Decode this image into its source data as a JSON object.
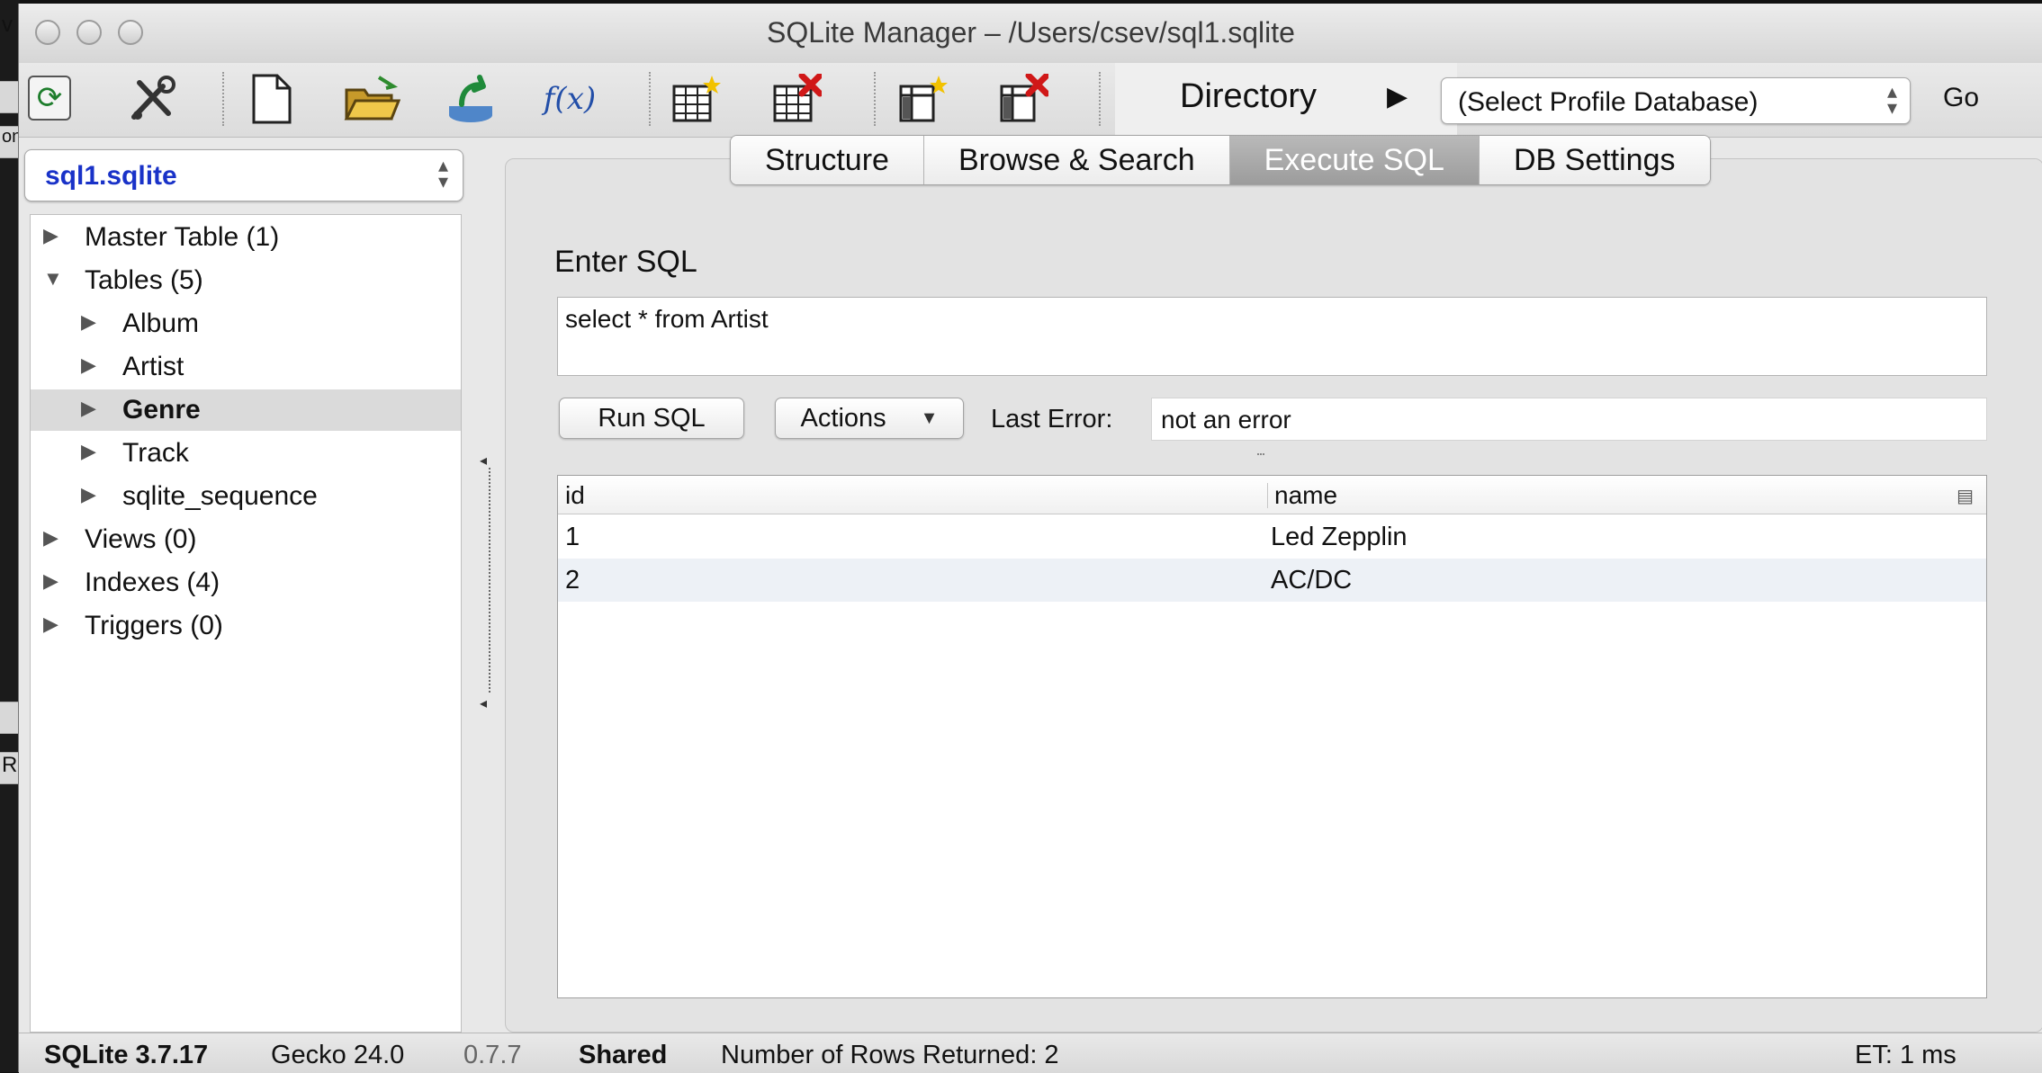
{
  "window": {
    "title": "SQLite Manager – /Users/csev/sql1.sqlite"
  },
  "background_left": {
    "letters": [
      "v",
      "on",
      "R"
    ]
  },
  "toolbar": {
    "fx_label": "f(x)",
    "directory_label": "Directory",
    "profile_select_value": "(Select Profile Database)",
    "go_label": "Go",
    "icons": [
      "reload-icon",
      "tools-icon",
      "new-db-icon",
      "open-db-icon",
      "export-icon",
      "function-icon",
      "create-table-icon",
      "drop-table-icon",
      "create-index-icon",
      "drop-index-icon"
    ]
  },
  "sidebar": {
    "db_select_value": "sql1.sqlite",
    "tree": [
      {
        "label": "Master Table (1)",
        "level": 0,
        "expanded": false,
        "selected": false
      },
      {
        "label": "Tables (5)",
        "level": 0,
        "expanded": true,
        "selected": false
      },
      {
        "label": "Album",
        "level": 1,
        "expanded": false,
        "selected": false
      },
      {
        "label": "Artist",
        "level": 1,
        "expanded": false,
        "selected": false
      },
      {
        "label": "Genre",
        "level": 1,
        "expanded": false,
        "selected": true
      },
      {
        "label": "Track",
        "level": 1,
        "expanded": false,
        "selected": false
      },
      {
        "label": "sqlite_sequence",
        "level": 1,
        "expanded": false,
        "selected": false
      },
      {
        "label": "Views (0)",
        "level": 0,
        "expanded": false,
        "selected": false
      },
      {
        "label": "Indexes (4)",
        "level": 0,
        "expanded": false,
        "selected": false
      },
      {
        "label": "Triggers (0)",
        "level": 0,
        "expanded": false,
        "selected": false
      }
    ]
  },
  "tabs": [
    {
      "label": "Structure",
      "active": false
    },
    {
      "label": "Browse & Search",
      "active": false
    },
    {
      "label": "Execute SQL",
      "active": true
    },
    {
      "label": "DB Settings",
      "active": false
    }
  ],
  "execute": {
    "enter_sql_label": "Enter SQL",
    "sql_text": "select * from Artist",
    "run_button": "Run SQL",
    "actions_button": "Actions",
    "last_error_label": "Last Error:",
    "last_error_value": "not an error"
  },
  "results": {
    "columns": [
      "id",
      "name"
    ],
    "rows": [
      [
        "1",
        "Led Zepplin"
      ],
      [
        "2",
        "AC/DC"
      ]
    ]
  },
  "status": {
    "sqlite_version": "SQLite 3.7.17",
    "gecko_version": "Gecko 24.0",
    "ext_version": "0.7.7",
    "shared": "Shared",
    "rows_returned": "Number of Rows Returned: 2",
    "elapsed": "ET: 1 ms"
  }
}
